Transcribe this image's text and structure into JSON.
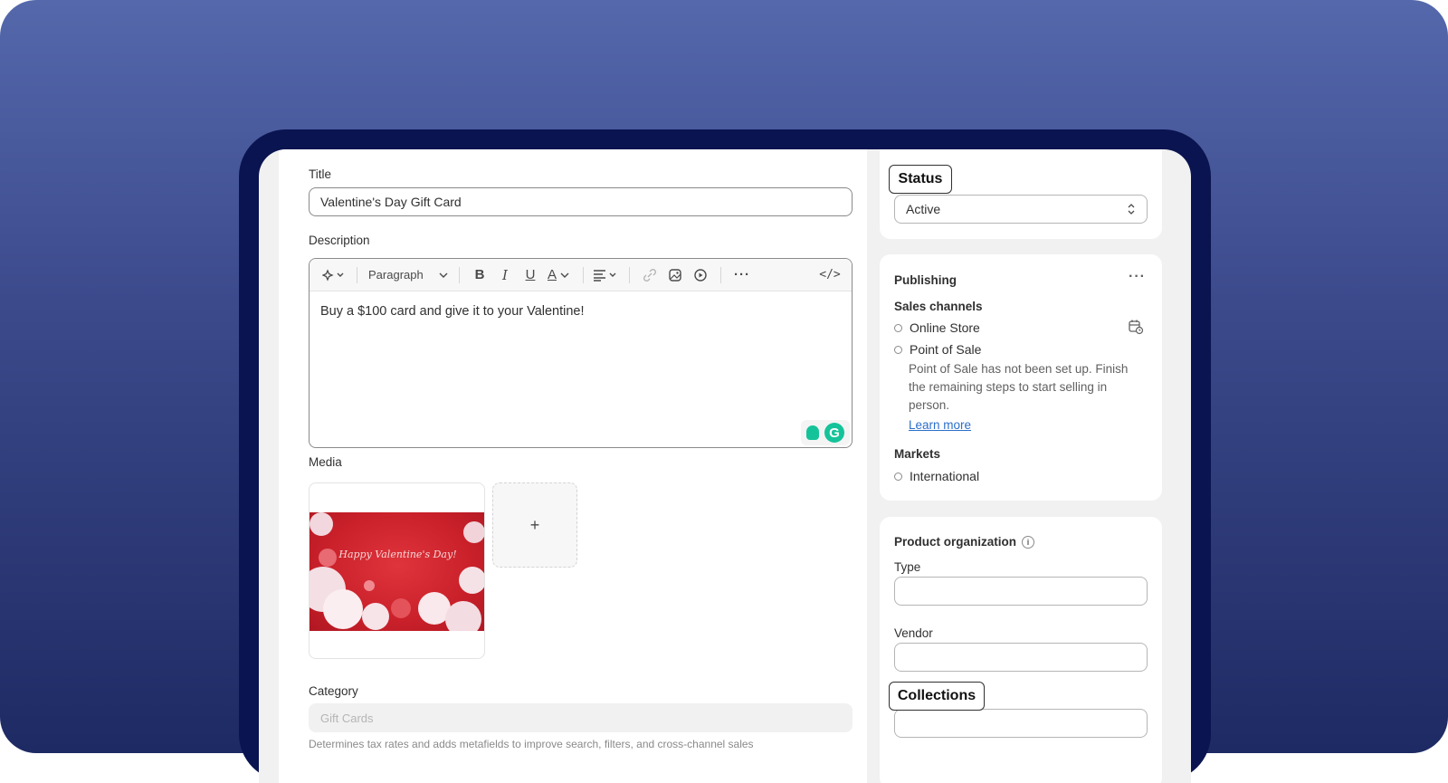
{
  "main": {
    "title_label": "Title",
    "title_value": "Valentine's Day Gift Card",
    "description_label": "Description",
    "toolbar": {
      "format_label": "Paragraph",
      "bold": "B",
      "italic": "I",
      "underline": "U",
      "text_color": "A",
      "more": "···",
      "code": "</>"
    },
    "description_text": "Buy a $100 card and give it to your Valentine!",
    "media_label": "Media",
    "media_image_text": "Happy Valentine's Day!",
    "media_add": "+",
    "category_label": "Category",
    "category_placeholder": "Gift Cards",
    "category_help": "Determines tax rates and adds metafields to improve search, filters, and cross-channel sales"
  },
  "status": {
    "highlight_label": "Status",
    "selected": "Active"
  },
  "publishing": {
    "heading": "Publishing",
    "menu": "···",
    "sales_channels_label": "Sales channels",
    "channels": [
      "Online Store",
      "Point of Sale"
    ],
    "pos_note_lines": [
      "Point of Sale has not been set up. Finish",
      "the remaining steps to start selling in",
      "person."
    ],
    "learn_more": "Learn more",
    "markets_label": "Markets",
    "markets": [
      "International"
    ]
  },
  "organization": {
    "heading": "Product organization",
    "type_label": "Type",
    "type_value": "",
    "vendor_label": "Vendor",
    "vendor_value": "",
    "collections_label": "Collections",
    "collections_value": ""
  },
  "colors": {
    "background_top": "#5468ab",
    "background_bottom": "#1e2a63",
    "device_frame": "#0a1450",
    "link": "#2c6ecb",
    "grammarly": "#15c39a"
  }
}
